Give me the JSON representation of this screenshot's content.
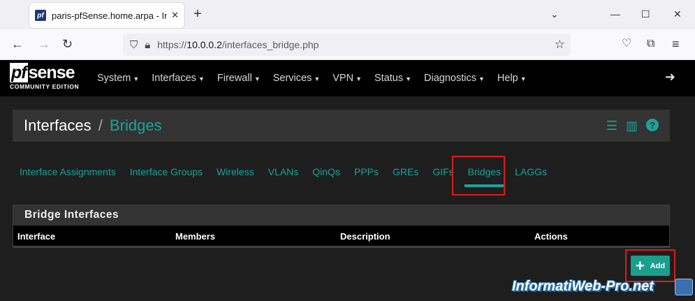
{
  "browser": {
    "tab_title": "paris-pfSense.home.arpa - Interfaces: Bridges",
    "tab_close": "✕",
    "new_tab": "+",
    "url_prefix": "https://",
    "url_host": "10.0.0.2",
    "url_path": "/interfaces_bridge.php",
    "icons": [
      "back-icon",
      "forward-icon",
      "reload-icon",
      "shield-icon",
      "lock-icon",
      "star-icon",
      "pocket-icon",
      "extensions-icon",
      "menu-icon",
      "minimize-icon",
      "maximize-icon",
      "close-icon"
    ]
  },
  "pfsense": {
    "logo_pf": "pf",
    "logo_text": "sense",
    "logo_edition": "COMMUNITY EDITION",
    "menu": [
      {
        "label": "System"
      },
      {
        "label": "Interfaces"
      },
      {
        "label": "Firewall"
      },
      {
        "label": "Services"
      },
      {
        "label": "VPN"
      },
      {
        "label": "Status"
      },
      {
        "label": "Diagnostics"
      },
      {
        "label": "Help"
      }
    ]
  },
  "breadcrumb": {
    "root": "Interfaces",
    "separator": "/",
    "current": "Bridges"
  },
  "subtabs": [
    {
      "label": "Interface Assignments"
    },
    {
      "label": "Interface Groups"
    },
    {
      "label": "Wireless"
    },
    {
      "label": "VLANs"
    },
    {
      "label": "QinQs"
    },
    {
      "label": "PPPs"
    },
    {
      "label": "GREs"
    },
    {
      "label": "GIFs"
    },
    {
      "label": "Bridges",
      "active": true
    },
    {
      "label": "LAGGs"
    }
  ],
  "panel": {
    "title": "Bridge Interfaces",
    "columns": [
      "Interface",
      "Members",
      "Description",
      "Actions"
    ]
  },
  "add_button": {
    "label": "Add"
  },
  "watermark": "InformatiWeb-Pro.net",
  "colors": {
    "accent": "#1aa39b",
    "highlight": "#e01b1b",
    "header_bg": "#000000",
    "page_bg": "#1e1e1e"
  }
}
